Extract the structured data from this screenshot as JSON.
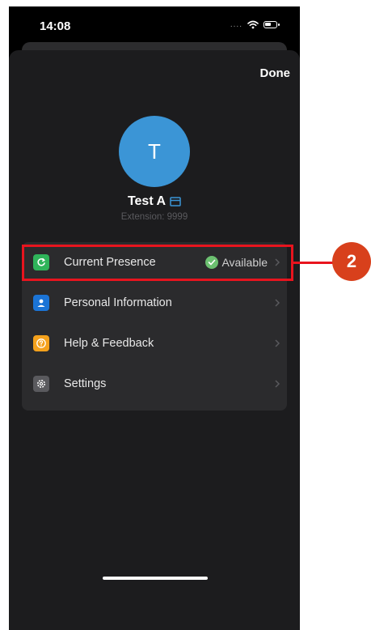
{
  "status_bar": {
    "time": "14:08",
    "signal": "....",
    "wifi_icon": "wifi-icon",
    "battery_icon": "battery-icon"
  },
  "header": {
    "done_label": "Done"
  },
  "profile": {
    "avatar_initial": "T",
    "avatar_color": "#3b95d6",
    "name": "Test A",
    "name_icon": "contact-card-icon",
    "extension": "Extension: 9999"
  },
  "menu": {
    "items": [
      {
        "label": "Current Presence",
        "icon": "presence-icon",
        "icon_color": "#2fb45a",
        "status": "Available",
        "status_color": "#6cc070"
      },
      {
        "label": "Personal Information",
        "icon": "person-icon",
        "icon_color": "#1b74d6"
      },
      {
        "label": "Help & Feedback",
        "icon": "help-icon",
        "icon_color": "#f4a11c"
      },
      {
        "label": "Settings",
        "icon": "gear-icon",
        "icon_color": "#5a5a5e"
      }
    ]
  },
  "annotation": {
    "step_number": "2",
    "color": "#e8141e"
  }
}
